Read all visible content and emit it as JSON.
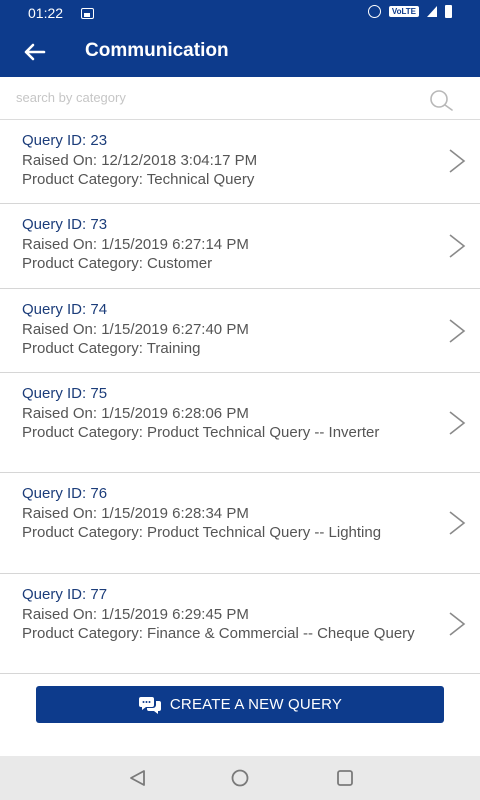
{
  "status": {
    "time": "01:22",
    "network": "VoLTE"
  },
  "app_bar": {
    "title": "Communication"
  },
  "search": {
    "placeholder": "search by category",
    "value": ""
  },
  "queries": [
    {
      "id": "Query ID: 23",
      "raised": "Raised On: 12/12/2018 3:04:17 PM",
      "category": "Product Category: Technical Query"
    },
    {
      "id": "Query ID: 73",
      "raised": "Raised On: 1/15/2019 6:27:14 PM",
      "category": "Product Category: Customer"
    },
    {
      "id": "Query ID: 74",
      "raised": "Raised On: 1/15/2019 6:27:40 PM",
      "category": "Product Category: Training"
    },
    {
      "id": "Query ID: 75",
      "raised": "Raised On: 1/15/2019 6:28:06 PM",
      "category": "Product Category: Product Technical Query -- Inverter"
    },
    {
      "id": "Query ID: 76",
      "raised": "Raised On: 1/15/2019 6:28:34 PM",
      "category": "Product Category: Product Technical Query -- Lighting"
    },
    {
      "id": "Query ID: 77",
      "raised": "Raised On: 1/15/2019 6:29:45 PM",
      "category": "Product Category: Finance & Commercial -- Cheque Query"
    }
  ],
  "actions": {
    "create_label": "CREATE A NEW QUERY"
  },
  "colors": {
    "brand": "#0d3b8c",
    "id_text": "#1c3d7a",
    "body_text": "#555555"
  },
  "icons": {
    "back": "arrow-left-icon",
    "search": "search-icon",
    "chevron": "chevron-right-icon",
    "chat": "chat-bubbles-icon",
    "nav_back": "triangle-back-icon",
    "nav_home": "circle-home-icon",
    "nav_recents": "square-recents-icon"
  }
}
